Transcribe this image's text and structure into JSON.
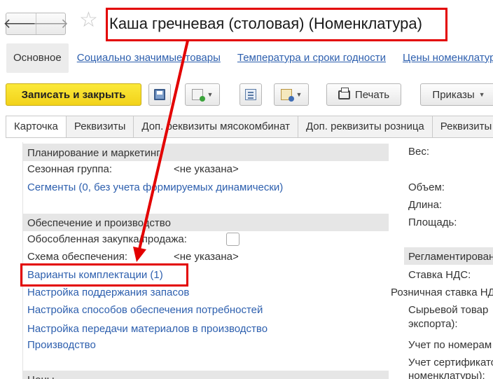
{
  "window": {
    "title": "Каша гречневая (столовая) (Номенклатура)",
    "back_icon": "arrow-left-icon",
    "forward_icon": "arrow-right-icon",
    "favorite_icon": "star-icon"
  },
  "nav_tabs": [
    "Основное",
    "Социально значимые товары",
    "Температура и сроки годности",
    "Цены номенклатуры"
  ],
  "toolbar": {
    "save_close": "Записать и закрыть",
    "print": "Печать",
    "orders": "Приказы"
  },
  "form_tabs": [
    "Карточка",
    "Реквизиты",
    "Доп. реквизиты мясокомбинат",
    "Доп. реквизиты розница",
    "Реквизиты"
  ],
  "sections": {
    "planning": {
      "header": "Планирование и маркетинг",
      "season_label": "Сезонная группа:",
      "season_value": "<не указана>",
      "segments_link": "Сегменты (0, без учета формируемых динамически)"
    },
    "supply": {
      "header": "Обеспечение и производство",
      "separate_purchase_label": "Обособленная закупка/продажа:",
      "scheme_label": "Схема обеспечения:",
      "scheme_value": "<не указана>",
      "links": [
        "Варианты комплектации (1)",
        "Настройка поддержания запасов",
        "Настройка способов обеспечения потребностей",
        "Настройка передачи материалов в производство",
        "Производство"
      ]
    },
    "prices_header": "Цены"
  },
  "right": {
    "weight": "Вес:",
    "volume": "Объем:",
    "length": "Длина:",
    "area": "Площадь:",
    "regulated_header": "Регламентированный учет",
    "vat": "Ставка НДС:",
    "retail_rate": "Розничная ставка НДС:",
    "raw_export_1": "Сырьевой товар",
    "raw_export_2": "экспорта):",
    "accounting_numbers": "Учет по номерам",
    "accounting_cert_1": "Учет сертификатов",
    "accounting_cert_2": "номенклатуры):"
  },
  "colors": {
    "annotation": "#e30000",
    "link": "#2d5fae",
    "primary_button": "#f2d21a"
  }
}
